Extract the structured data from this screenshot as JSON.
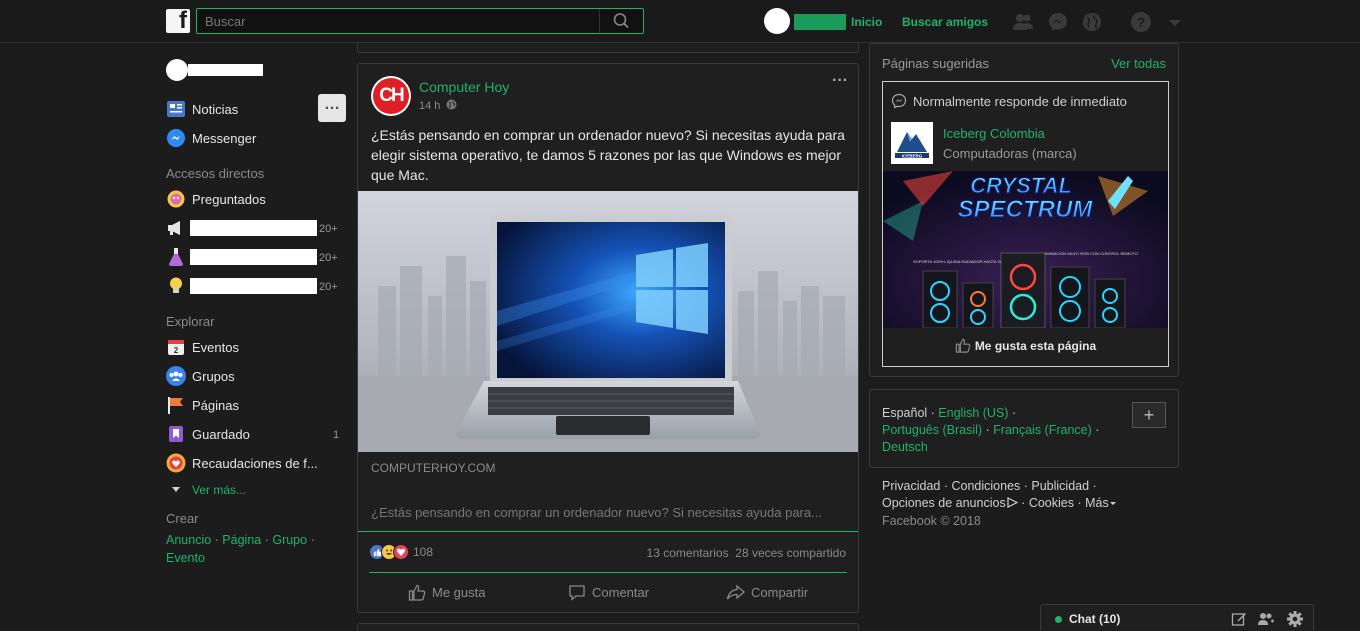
{
  "topbar": {
    "logo": "f",
    "search_placeholder": "Buscar",
    "nav_home": "Inicio",
    "nav_find_friends": "Buscar amigos"
  },
  "sidebar": {
    "main_items": [
      {
        "label": "Noticias",
        "icon": "news-feed-icon"
      },
      {
        "label": "Messenger",
        "icon": "messenger-icon"
      }
    ],
    "shortcuts_title": "Accesos directos",
    "shortcuts": [
      {
        "label": "Preguntados",
        "icon": "preguntados-icon"
      },
      {
        "label": "",
        "icon": "megaphone-icon",
        "count": "20+"
      },
      {
        "label": "",
        "icon": "flask-icon",
        "count": "20+"
      },
      {
        "label": "",
        "icon": "lightbulb-icon",
        "count": "20+"
      }
    ],
    "explore_title": "Explorar",
    "explore": [
      {
        "label": "Eventos",
        "icon": "calendar-icon",
        "count": ""
      },
      {
        "label": "Grupos",
        "icon": "groups-icon",
        "count": ""
      },
      {
        "label": "Páginas",
        "icon": "flag-icon",
        "count": ""
      },
      {
        "label": "Guardado",
        "icon": "bookmark-icon",
        "count": "1"
      },
      {
        "label": "Recaudaciones de f...",
        "icon": "fundraiser-icon",
        "count": ""
      }
    ],
    "see_more": "Ver más...",
    "create_title": "Crear",
    "create_links": [
      "Anuncio",
      "Página",
      "Grupo",
      "Evento"
    ]
  },
  "post": {
    "author": "Computer Hoy",
    "avatar_text": "CH",
    "time": "14 h",
    "text": "¿Estás pensando en comprar un ordenador nuevo? Si necesitas ayuda para elegir sistema operativo, te damos 5 razones por las que Windows es mejor que Mac.",
    "link_domain": "COMPUTERHOY.COM",
    "link_description": "¿Estás pensando en comprar un ordenador nuevo? Si necesitas ayuda para...",
    "reaction_count": "108",
    "comments": "13 comentarios",
    "shares": "28 veces compartido",
    "actions": {
      "like": "Me gusta",
      "comment": "Comentar",
      "share": "Compartir"
    }
  },
  "suggested": {
    "title": "Páginas sugeridas",
    "see_all": "Ver todas",
    "responds": "Normalmente responde de inmediato",
    "page_name": "Iceberg Colombia",
    "page_category": "Computadoras (marca)",
    "logo_text": "ICEBERG",
    "ad_title_line1": "CRYSTAL",
    "ad_title_line2": "SPECTRUM",
    "ad_caption_left": "SOPORTA 100% LIQUIDA RADIADOR HASTA 360MM",
    "ad_caption_right": "SISTEMA DE ILUMINACIÓN MULTI RGB CON CONTROL REMOTO",
    "like_page": "Me gusta esta página"
  },
  "languages": {
    "current": "Español",
    "others": [
      "English (US)",
      "Português (Brasil)",
      "Français (France)",
      "Deutsch"
    ],
    "add": "+"
  },
  "footer": {
    "line1": [
      "Privacidad",
      "Condiciones",
      "Publicidad"
    ],
    "ad_options": "Opciones de anuncios",
    "cookies": "Cookies",
    "more": "Más",
    "copyright": "Facebook © 2018"
  },
  "chat": {
    "label": "Chat (10)"
  },
  "colors": {
    "accent": "#21b36a",
    "background": "#1c1c1c",
    "card": "#1f1f1f"
  }
}
